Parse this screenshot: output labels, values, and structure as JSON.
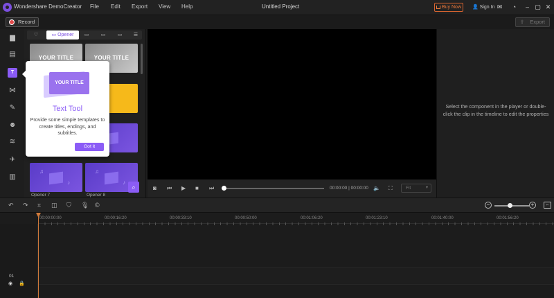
{
  "app": {
    "name": "Wondershare DemoCreator",
    "document_title": "Untitled Project",
    "menu": [
      "File",
      "Edit",
      "Export",
      "View",
      "Help"
    ],
    "buy_now": "Buy Now",
    "sign_in": "Sign In",
    "accent_color": "#8b5cf6",
    "brand_orange": "#f07a3c"
  },
  "toolbar": {
    "record_label": "Record",
    "export_label": "Export"
  },
  "library": {
    "active_tab": "Opener",
    "items": [
      {
        "label": "Opener 7"
      },
      {
        "label": "Opener 8"
      }
    ],
    "thumb_title": "YOUR TITLE"
  },
  "popover": {
    "illustration_text": "YOUR TITLE",
    "title": "Text Tool",
    "description": "Provide some simple templates to create titles, endings, and subtitles.",
    "button": "Got it"
  },
  "player": {
    "timecode": "00:00:00 | 00:00:00",
    "fit_label": "Fit"
  },
  "properties": {
    "hint": "Select the component in the player or double-click the clip in the timeline to edit the properties"
  },
  "timeline": {
    "ruler_labels": [
      "00:00:00:00",
      "00:00:16:20",
      "00:00:33:10",
      "00:00:50:00",
      "00:01:06:20",
      "00:01:23:10",
      "00:01:40:00",
      "00:01:56:20"
    ],
    "track_number": "01"
  }
}
